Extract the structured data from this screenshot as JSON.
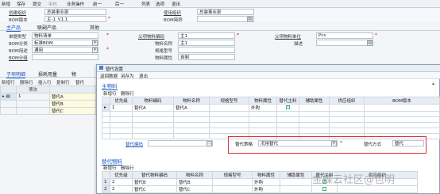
{
  "toolbar": {
    "items": [
      "新增",
      "保存",
      "提交",
      "审核",
      "业务操作",
      "前一",
      "后一",
      "列表",
      "选项",
      "退出"
    ]
  },
  "header": {
    "create_org_label": "创建组织",
    "create_org_value": "总装事业部",
    "use_org_label": "使用组织",
    "use_org_value": "总装事业部",
    "bom_version_label": "BOM版本",
    "bom_version_value": "主-1_V1.1",
    "bom_short_label": "BOM简称"
  },
  "tabs": {
    "main": "主产品",
    "co": "联副产品",
    "other": "其他"
  },
  "main_form": {
    "group_label": "单据类型",
    "group_value": "物料清单",
    "bom_cat_label": "BOM分类",
    "bom_cat_value": "标准BOM",
    "bom_use_label": "BOM用途",
    "bom_use_value": "通用",
    "bom_group_label": "BOM分组",
    "material_code_label": "父项物料编码",
    "material_code_value": "主1",
    "material_name_label": "物料名称",
    "material_name_value": "主1",
    "spec_label": "规格型号",
    "attr_label": "物料属性",
    "attr_value": "自制",
    "parent_unit_label": "父项物料单位",
    "parent_unit_value": "Pcs",
    "desc_label": "描述"
  },
  "sub_section": {
    "tab_detail": "子项明细",
    "tab_loss": "损耗用量",
    "tab_more": "物",
    "btn_add": "新增行",
    "btn_delete": "删除行",
    "btn_insert": "插入行",
    "btn_copy": "复制行",
    "col_no": "项次",
    "rows": [
      {
        "no": "1",
        "code": "替代A"
      },
      {
        "no": "",
        "code": "替代B"
      },
      {
        "no": "",
        "code": "替代C"
      }
    ],
    "sub_code_header": "子项物料编码"
  },
  "dialog": {
    "title": "替代设置",
    "tools": [
      "返回数据",
      "另存为",
      "退出"
    ],
    "main_section": "主物料",
    "btn_add": "新增行",
    "btn_delete": "删除行",
    "headers": [
      "优先级",
      "物料编码",
      "物料名称",
      "规格型号",
      "物料属性",
      "替代主料",
      "辅助属性",
      "供应组织",
      "BOM版本"
    ],
    "main_rows": [
      {
        "pri": "1",
        "code": "替代A",
        "name": "替代A",
        "spec": "",
        "attr": "外购",
        "main": true
      }
    ],
    "sub_code_label": "替代编码",
    "strategy_label": "替代策略",
    "strategy_value": "况用替代",
    "mode_label": "替代方式",
    "mode_value": "替代",
    "alt_section": "替代物料",
    "alt_headers": [
      "优先级",
      "替代物料编码",
      "物料名称",
      "规格型号",
      "物料属性",
      "辅助属性",
      "替代主料",
      "供应组织"
    ],
    "alt_rows": [
      {
        "no": "1",
        "pri": "2",
        "code": "替代B",
        "name": "替代B",
        "attr": "外购",
        "main": true
      },
      {
        "no": "2",
        "pri": "2",
        "code": "替代C",
        "name": "替代C",
        "attr": "外购",
        "main": false
      }
    ]
  },
  "watermark": "金蝶云社区@包明"
}
